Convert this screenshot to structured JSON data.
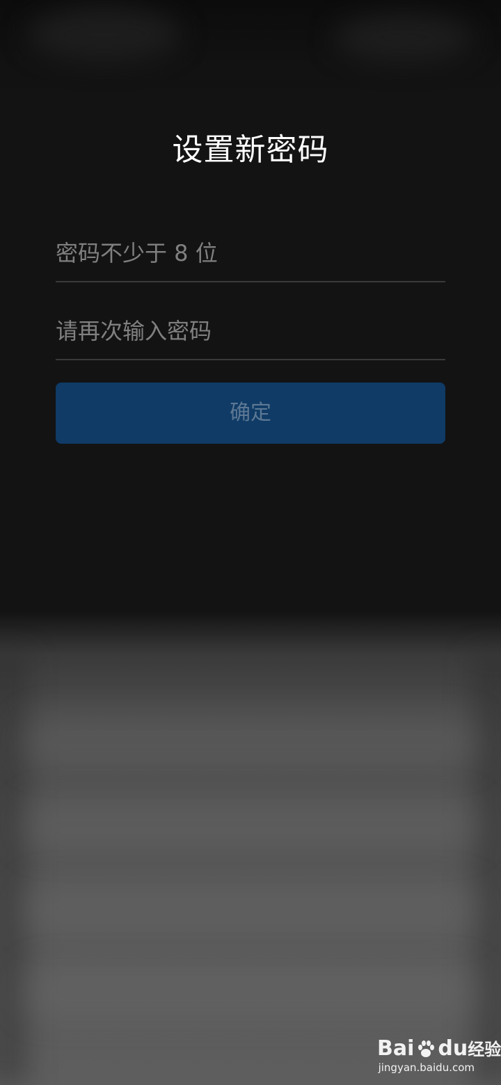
{
  "title": "设置新密码",
  "password_field": {
    "placeholder": "密码不少于 8 位",
    "value": ""
  },
  "confirm_field": {
    "placeholder": "请再次输入密码",
    "value": ""
  },
  "confirm_button_label": "确定",
  "watermark": {
    "logo_part1": "Bai",
    "logo_part2": "du",
    "logo_cn": "经验",
    "url": "jingyan.baidu.com"
  },
  "colors": {
    "background": "#131313",
    "button": "#0f3b66",
    "button_text": "#5d7894",
    "placeholder": "#808080",
    "title": "#ffffff"
  }
}
